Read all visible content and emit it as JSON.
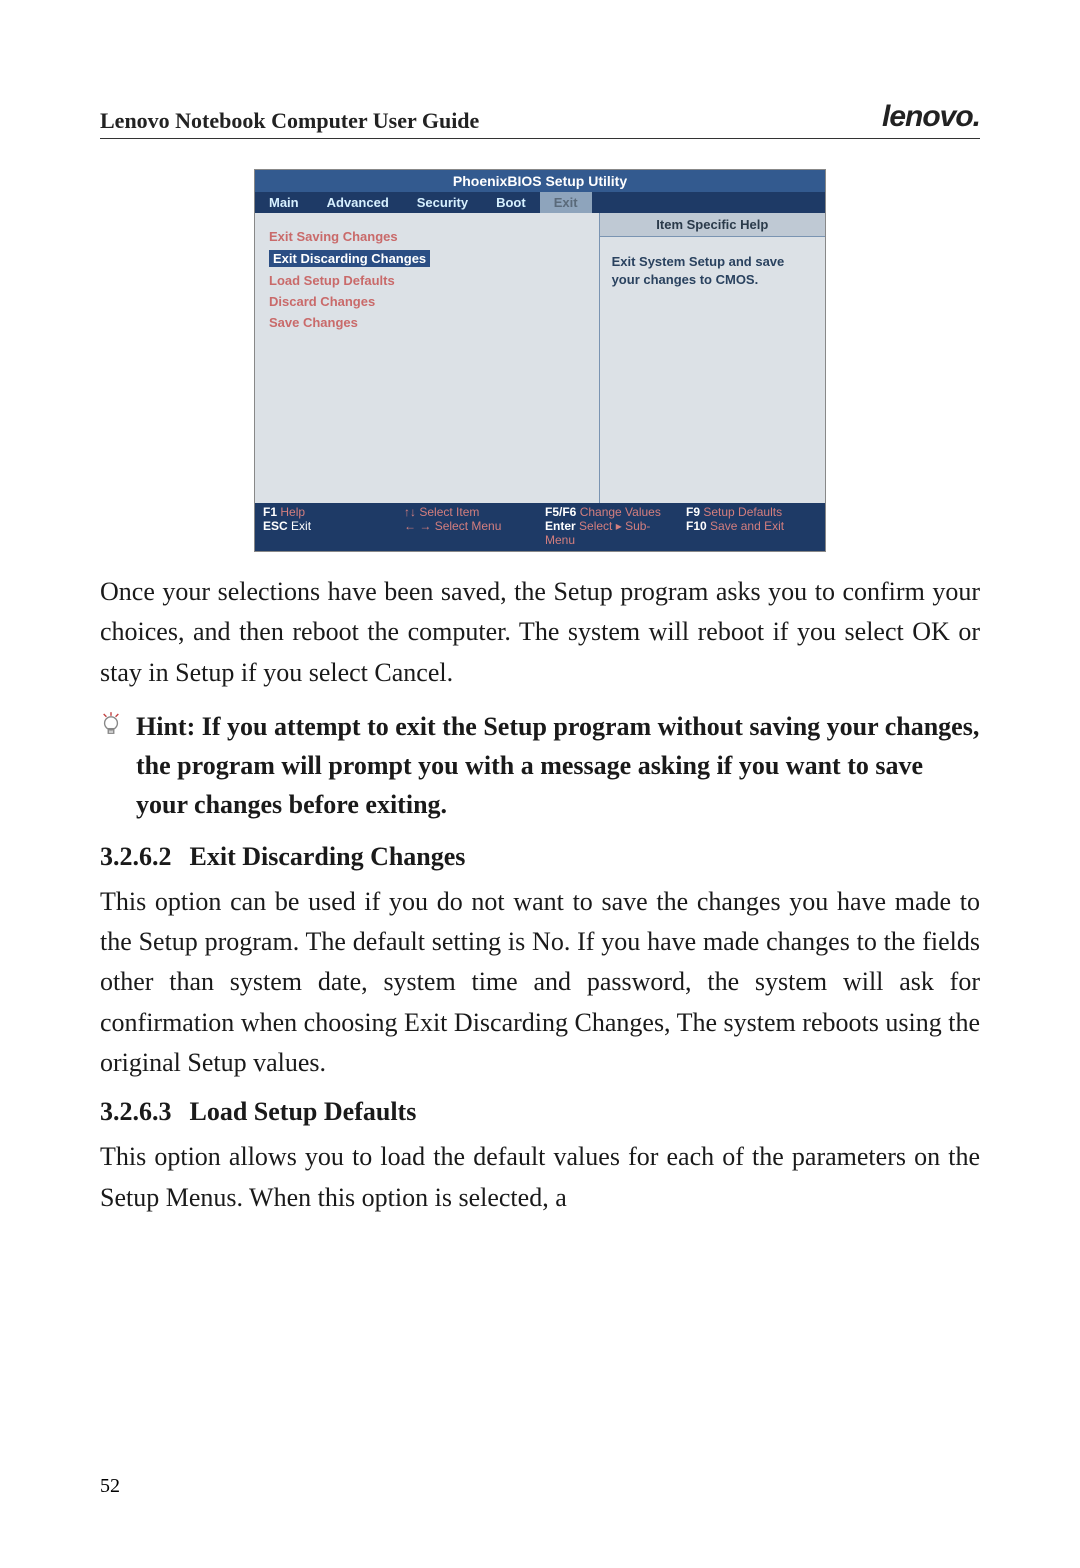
{
  "header": {
    "title": "Lenovo Notebook Computer User Guide",
    "logo": "lenovo."
  },
  "bios": {
    "title": "PhoenixBIOS Setup Utility",
    "tabs": [
      "Main",
      "Advanced",
      "Security",
      "Boot",
      "Exit"
    ],
    "active_tab_index": 4,
    "menu_items": [
      "Exit Saving Changes",
      "Exit Discarding Changes",
      "Load Setup Defaults",
      "Discard Changes",
      "Save Changes"
    ],
    "selected_index": 1,
    "help_title": "Item Specific Help",
    "help_body": "Exit System Setup and save your changes to CMOS.",
    "footer": {
      "f1": "F1",
      "f1_label": "Help",
      "esc": "ESC",
      "esc_label": "Exit",
      "updown": "↑↓",
      "updown_label": "Select Item",
      "leftright": "← →",
      "leftright_label": "Select Menu",
      "f5f6": "F5/F6",
      "f5f6_label": "Change Values",
      "enter": "Enter",
      "enter_label": "Select ▸ Sub-Menu",
      "f9": "F9",
      "f9_label": "Setup Defaults",
      "f10": "F10",
      "f10_label": "Save and Exit"
    }
  },
  "body": {
    "para1": "Once your selections have been saved, the Setup program asks you to confirm your choices, and then reboot the computer. The system will reboot if you select OK or stay in Setup if you select Cancel.",
    "hint": "Hint: If you attempt to exit the Setup program without saving your changes, the program will prompt you with a message asking if you want to save your changes before exiting.",
    "sec2_num": "3.2.6.2",
    "sec2_title": "Exit Discarding Changes",
    "para2": "This option can be used if you do not want to save the changes you have made to the Setup program. The default setting is No. If you have made changes to the fields other than system date, system time and password, the system will ask for confirmation when choosing Exit Discarding Changes, The system reboots using the original Setup values.",
    "sec3_num": "3.2.6.3",
    "sec3_title": "Load Setup Defaults",
    "para3": "This option allows you to load the default values for each of the parameters on the Setup Menus. When this option is selected, a"
  },
  "page_number": "52"
}
